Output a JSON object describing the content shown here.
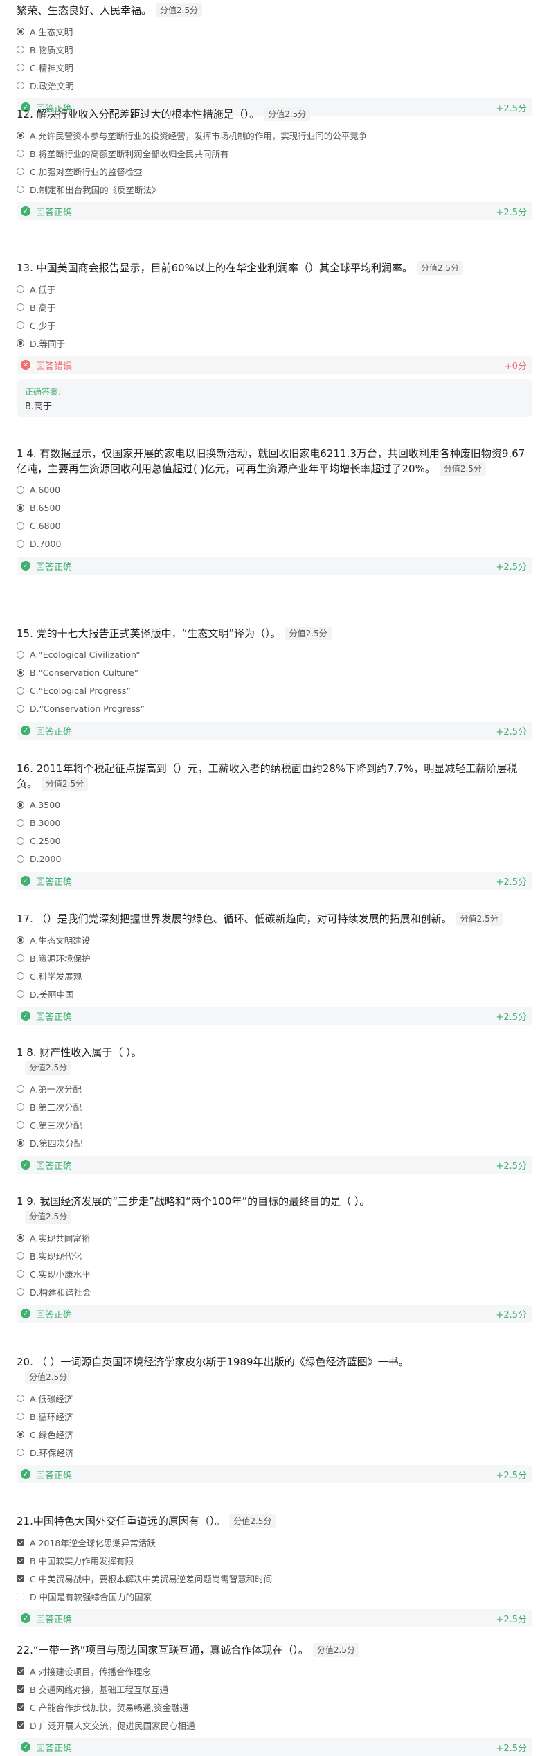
{
  "questions": [
    {
      "id": "q11",
      "title": "繁荣、生态良好、人民幸福。",
      "score": "分值2.5分",
      "type": "radio",
      "selected": 0,
      "options": [
        "A.生态文明",
        "B.物质文明",
        "C.精神文明",
        "D.政治文明"
      ],
      "result": {
        "status": "ok",
        "text": "回答正确",
        "points": "+2.5分"
      }
    },
    {
      "id": "q12",
      "title": "12. 解决行业收入分配差距过大的根本性措施是（）。",
      "score": "分值2.5分",
      "type": "radio",
      "selected": 0,
      "options": [
        "A.允许民营资本参与垄断行业的投资经营，发挥市场机制的作用，实现行业间的公平竞争",
        "B.将垄断行业的高额垄断利润全部收归全民共同所有",
        "C.加强对垄断行业的监督检查",
        "D.制定和出台我国的《反垄断法》"
      ],
      "result": {
        "status": "ok",
        "text": "回答正确",
        "points": "+2.5分"
      }
    },
    {
      "id": "q13",
      "title": "13. 中国美国商会报告显示，目前60%以上的在华企业利润率（）其全球平均利润率。",
      "score": "分值2.5分",
      "type": "radio",
      "selected": 3,
      "options": [
        "A.低于",
        "B.高于",
        "C.少于",
        "D.等同于"
      ],
      "result": {
        "status": "bad",
        "text": "回答错误",
        "points": "+0分"
      },
      "answer": {
        "label": "正确答案:",
        "value": "B.高于"
      }
    },
    {
      "id": "q14",
      "title": "1 4. 有数据显示，仅国家开展的家电以旧换新活动，就回收旧家电6211.3万台，共回收利用各种废旧物资9.67亿吨，主要再生资源回收利用总值超过(  )亿元，可再生资源产业年平均增长率超过了20%。",
      "score": "分值2.5分",
      "type": "radio",
      "selected": 1,
      "options": [
        "A.6000",
        "B.6500",
        "C.6800",
        "D.7000"
      ],
      "result": {
        "status": "ok",
        "text": "回答正确",
        "points": "+2.5分"
      }
    },
    {
      "id": "q15",
      "title": "15. 党的十七大报告正式英译版中，“生态文明”译为（）。",
      "score": "分值2.5分",
      "type": "radio",
      "selected": 1,
      "options": [
        "A.“Ecological Civilization”",
        "B.“Conservation Culture”",
        "C.“Ecological Progress”",
        "D.“Conservation Progress”"
      ],
      "result": {
        "status": "ok",
        "text": "回答正确",
        "points": "+2.5分"
      }
    },
    {
      "id": "q16",
      "title": "16. 2011年将个税起征点提高到（）元，工薪收入者的纳税面由约28%下降到约7.7%，明显减轻工薪阶层税负。",
      "score": "分值2.5分",
      "type": "radio",
      "selected": 0,
      "options": [
        "A.3500",
        "B.3000",
        "C.2500",
        "D.2000"
      ],
      "result": {
        "status": "ok",
        "text": "回答正确",
        "points": "+2.5分"
      }
    },
    {
      "id": "q17",
      "title": "17.  （）是我们党深刻把握世界发展的绿色、循环、低碳新趋向，对可持续发展的拓展和创新。",
      "score": "分值2.5分",
      "type": "radio",
      "selected": 0,
      "options": [
        "A.生态文明建设",
        "B.资源环境保护",
        "C.科学发展观",
        "D.美丽中国"
      ],
      "result": {
        "status": "ok",
        "text": "回答正确",
        "points": "+2.5分"
      }
    },
    {
      "id": "q18",
      "title": "1 8. 财产性收入属于（ ）。",
      "score": "分值2.5分",
      "scoreBlock": true,
      "type": "radio",
      "selected": 3,
      "options": [
        "A.第一次分配",
        "B.第二次分配",
        "C.第三次分配",
        "D.第四次分配"
      ],
      "result": {
        "status": "ok",
        "text": "回答正确",
        "points": "+2.5分"
      }
    },
    {
      "id": "q19",
      "title": "1 9. 我国经济发展的“三步走”战略和“两个100年”的目标的最终目的是（ ）。",
      "score": "分值2.5分",
      "scoreBlock": true,
      "type": "radio",
      "selected": 0,
      "options": [
        "A.实现共同富裕",
        "B.实现现代化",
        "C.实现小康水平",
        "D.构建和谐社会"
      ],
      "result": {
        "status": "ok",
        "text": "回答正确",
        "points": "+2.5分"
      }
    },
    {
      "id": "q20",
      "title": "20. （ ）一词源自英国环境经济学家皮尔斯于1989年出版的《绿色经济蓝图》一书。",
      "score": "分值2.5分",
      "scoreBlock": true,
      "type": "radio",
      "selected": 2,
      "options": [
        "A.低碳经济",
        "B.循环经济",
        "C.绿色经济",
        "D.环保经济"
      ],
      "result": {
        "status": "ok",
        "text": "回答正确",
        "points": "+2.5分"
      }
    },
    {
      "id": "q21",
      "title": "21.中国特色大国外交任重道远的原因有（）。",
      "score": "分值2.5分",
      "type": "checkbox",
      "selected": [
        0,
        1,
        2
      ],
      "options": [
        "A 2018年逆全球化思潮异常活跃",
        "B 中国软实力作用发挥有限",
        "C 中美贸易战中，要根本解决中美贸易逆差问题尚需智慧和时间",
        "D 中国是有较强综合国力的国家"
      ],
      "result": {
        "status": "ok",
        "text": "回答正确",
        "points": "+2.5分"
      }
    },
    {
      "id": "q22",
      "title": "22.“一带一路”项目与周边国家互联互通，真诚合作体现在（）。",
      "score": "分值2.5分",
      "type": "checkbox",
      "selected": [
        0,
        1,
        2,
        3
      ],
      "options": [
        "A 对接建设项目，传播合作理念",
        "B 交通网络对接，基础工程互联互通",
        "C 产能合作步伐加快，贸易畅通,资金融通",
        "D 广泛开展人文交流，促进民国家民心相通"
      ],
      "result": {
        "status": "ok",
        "text": "回答正确",
        "points": "+2.5分"
      }
    }
  ]
}
